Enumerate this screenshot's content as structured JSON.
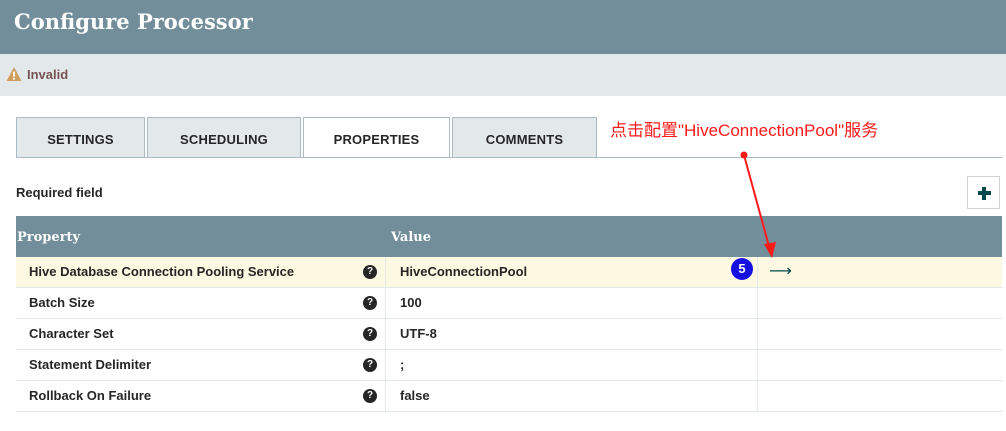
{
  "dialog": {
    "title": "Configure Processor",
    "status": "Invalid"
  },
  "tabs": [
    {
      "label": "SETTINGS",
      "selected": false
    },
    {
      "label": "SCHEDULING",
      "selected": false
    },
    {
      "label": "PROPERTIES",
      "selected": true
    },
    {
      "label": "COMMENTS",
      "selected": false
    }
  ],
  "annotation": {
    "text": "点击配置\"HiveConnectionPool\"服务",
    "color": "#ff1a1a",
    "badge": "5"
  },
  "properties": {
    "required_label": "Required field",
    "columns": {
      "property": "Property",
      "value": "Value"
    },
    "rows": [
      {
        "name": "Hive Database Connection Pooling Service",
        "value": "HiveConnectionPool",
        "highlighted": true,
        "action_icon": "arrow-right-icon"
      },
      {
        "name": "Batch Size",
        "value": "100",
        "highlighted": false
      },
      {
        "name": "Character Set",
        "value": "UTF-8",
        "highlighted": false
      },
      {
        "name": "Statement Delimiter",
        "value": ";",
        "highlighted": false
      },
      {
        "name": "Rollback On Failure",
        "value": "false",
        "highlighted": false
      }
    ]
  },
  "colors": {
    "header": "#728e9b",
    "status_bg": "#e3e8eb",
    "highlight_row": "#fdf8e2",
    "badge": "#1610e0"
  }
}
